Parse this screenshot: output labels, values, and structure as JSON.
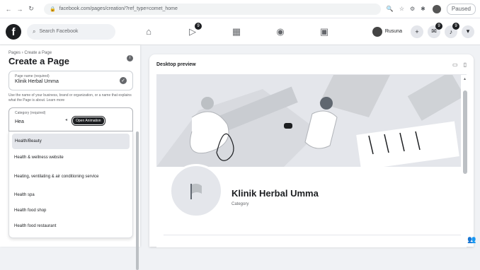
{
  "browser": {
    "url": "facebook.com/pages/creation/?ref_type=comet_home",
    "paused_label": "Paused"
  },
  "fb": {
    "search_placeholder": "Search Facebook",
    "nav_badge_watch": "9",
    "profile_name": "Rusuna",
    "messenger_badge": "9",
    "notif_badge": "9"
  },
  "left": {
    "breadcrumb": "Pages › Create a Page",
    "title": "Create a Page",
    "name_field": {
      "label": "Page name (required)",
      "value": "Klinik Herbal Umma"
    },
    "hint": "Use the name of your business, brand or organization, or a name that explains what the Page is about. Learn more",
    "category_field": {
      "label": "Category (required)",
      "value": "Hea"
    },
    "options": [
      "Health/Beauty",
      "Health & wellness website",
      "Heating, ventilating & air conditioning service",
      "Health spa",
      "Health food shop",
      "Health food restaurant"
    ],
    "tooltip": "Open Animation"
  },
  "preview": {
    "title": "Desktop preview",
    "page_name": "Klinik Herbal Umma",
    "category": "Category"
  },
  "colors": {
    "accent": "#1c1e21",
    "background": "#f0f2f5"
  }
}
